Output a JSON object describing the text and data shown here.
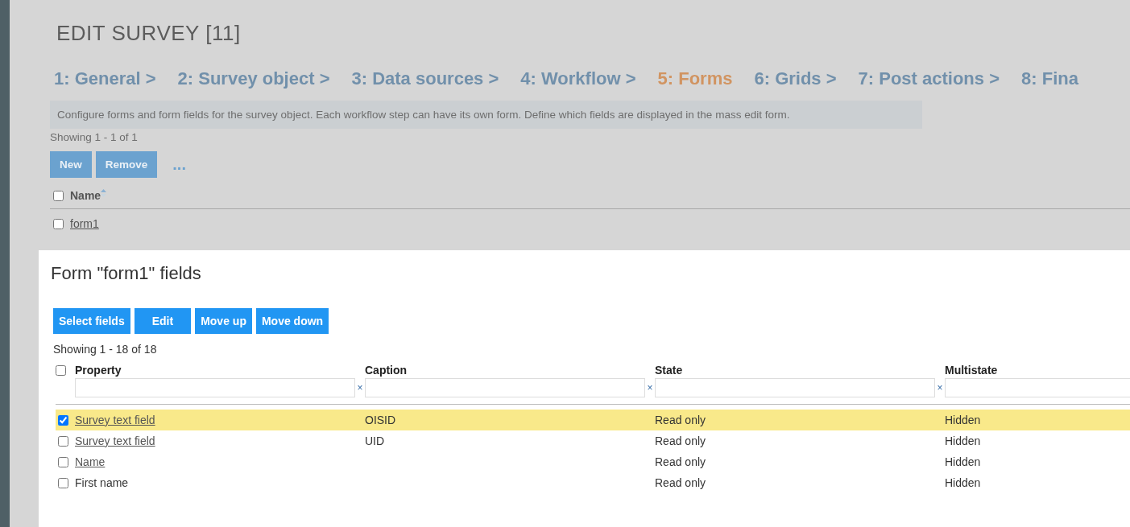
{
  "page_title": "EDIT SURVEY [11]",
  "steps": [
    {
      "label": "1: General >",
      "selected": false
    },
    {
      "label": "2: Survey object >",
      "selected": false
    },
    {
      "label": "3: Data sources >",
      "selected": false
    },
    {
      "label": "4: Workflow >",
      "selected": false
    },
    {
      "label": "5: Forms",
      "selected": true
    },
    {
      "label": "6: Grids >",
      "selected": false
    },
    {
      "label": "7: Post actions >",
      "selected": false
    },
    {
      "label": "8: Fina",
      "selected": false
    }
  ],
  "info": "Configure forms and form fields for the survey object. Each workflow step can have its own form. Define which fields are displayed in the mass edit form.",
  "forms_list": {
    "showing": "Showing 1 - 1 of 1",
    "buttons": [
      "New",
      "Remove"
    ],
    "more": "...",
    "select_all_checked": false,
    "columns": [
      {
        "label": "Name",
        "sorted": true
      }
    ],
    "rows": [
      {
        "name": "form1",
        "checked": false
      }
    ]
  },
  "dialog": {
    "title": "Form \"form1\" fields",
    "buttons": [
      "Select fields",
      "Edit",
      "Move up",
      "Move down"
    ],
    "showing": "Showing 1 - 18 of 18",
    "select_all_checked": false,
    "columns": [
      "Property",
      "Caption",
      "State",
      "Multistate"
    ],
    "clear_filter": "×",
    "rows": [
      {
        "property": "Survey text field",
        "property_link": true,
        "caption": "OISID",
        "state": "Read only",
        "multistate": "Hidden",
        "checked": true
      },
      {
        "property": "Survey text field",
        "property_link": true,
        "caption": "UID",
        "state": "Read only",
        "multistate": "Hidden",
        "checked": false
      },
      {
        "property": "Name",
        "property_link": true,
        "caption": "",
        "state": "Read only",
        "multistate": "Hidden",
        "checked": false
      },
      {
        "property": "First name",
        "property_link": false,
        "caption": "",
        "state": "Read only",
        "multistate": "Hidden",
        "checked": false
      }
    ]
  }
}
